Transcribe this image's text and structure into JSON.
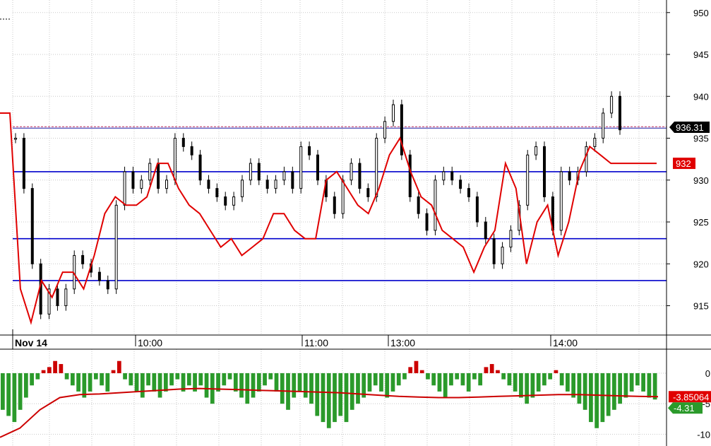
{
  "chart_data": [
    {
      "type": "candlestick",
      "x_labels": [
        "Nov 14",
        "10:00",
        "11:00",
        "13:00",
        "14:00"
      ],
      "y_ticks": [
        915,
        920,
        925,
        930,
        935,
        940,
        945,
        950
      ],
      "ylim": [
        911.5,
        951.5
      ],
      "grid": true,
      "horizontal_levels": [
        918,
        923,
        931,
        936.2
      ],
      "last_price": 936.31,
      "last_price_label": "936.31",
      "line_value_label": "932",
      "price_closes": [
        935,
        929,
        920,
        914,
        917,
        915,
        917,
        921,
        920,
        919,
        918,
        917,
        927,
        931,
        929,
        930,
        932,
        929,
        930,
        935,
        934,
        933,
        930,
        929,
        928,
        927,
        928,
        930,
        932,
        930,
        929,
        930,
        931,
        929,
        934,
        933,
        930,
        928,
        926,
        930,
        932,
        929,
        928,
        935,
        937,
        939,
        933,
        928,
        926,
        924,
        930,
        931,
        930,
        929,
        928,
        925,
        923,
        920,
        922,
        924,
        927,
        933,
        934,
        928,
        924,
        931,
        930,
        931,
        934,
        935,
        938,
        940,
        936
      ],
      "red_line": [
        938,
        917,
        913,
        918,
        916,
        919,
        919,
        917,
        921,
        926,
        928,
        927,
        927,
        928,
        932,
        932,
        929,
        927,
        926,
        924,
        922,
        923,
        921,
        922,
        923,
        926,
        926,
        924,
        923,
        923,
        930,
        931,
        929,
        927,
        926,
        929,
        933,
        935,
        931,
        928,
        927,
        924,
        923,
        922,
        919,
        922,
        924,
        932,
        929,
        920,
        925,
        927,
        921,
        925,
        931,
        934,
        933,
        932
      ],
      "oscillator": {
        "ylim": [
          -11,
          0
        ],
        "y_ticks": [
          0,
          -5,
          -10
        ],
        "signal_label": "-3.85064",
        "histogram_label": "-4.31",
        "histogram": [
          -6,
          -7,
          -8,
          -6,
          -4,
          -2,
          -1,
          0.5,
          1,
          2,
          1.5,
          -1,
          -2,
          -3,
          -4,
          -3,
          -1,
          -2,
          -3,
          0.5,
          2,
          -1,
          -2,
          -3,
          -4,
          -2,
          -3,
          -4,
          -3,
          -2,
          -1,
          -3,
          -2,
          -3,
          -2,
          -4,
          -5,
          -3,
          -2,
          -1,
          -3,
          -4,
          -5,
          -4,
          -3,
          -2,
          -1,
          -3,
          -5,
          -6,
          -4,
          -3,
          -4,
          -5,
          -7,
          -8,
          -9,
          -8,
          -7,
          -8,
          -6,
          -5,
          -4,
          -3,
          -2,
          -3,
          -4,
          -3,
          -2,
          -1,
          1,
          2,
          0.5,
          -1,
          -2,
          -3,
          -4,
          -2,
          -1,
          -2,
          -3,
          -1,
          -2,
          1,
          1.5,
          0.5,
          -1,
          -2,
          -3,
          -4,
          -5,
          -4,
          -3,
          -2,
          -1,
          0.5,
          -2,
          -3,
          -4,
          -5,
          -6,
          -8,
          -9,
          -8,
          -7,
          -6,
          -5,
          -4,
          -3,
          -2,
          -3,
          -4,
          -4.31
        ],
        "signal": [
          -10.5,
          -9,
          -6,
          -4,
          -3.5,
          -3.4,
          -3.2,
          -3,
          -2.8,
          -2.6,
          -2.5,
          -2.6,
          -2.7,
          -2.8,
          -2.9,
          -3,
          -3.1,
          -3.2,
          -3.4,
          -3.6,
          -3.8,
          -3.9,
          -4,
          -4,
          -3.9,
          -3.8,
          -3.7,
          -3.6,
          -3.5,
          -3.5,
          -3.6,
          -3.7,
          -3.8,
          -3.85
        ]
      }
    }
  ]
}
